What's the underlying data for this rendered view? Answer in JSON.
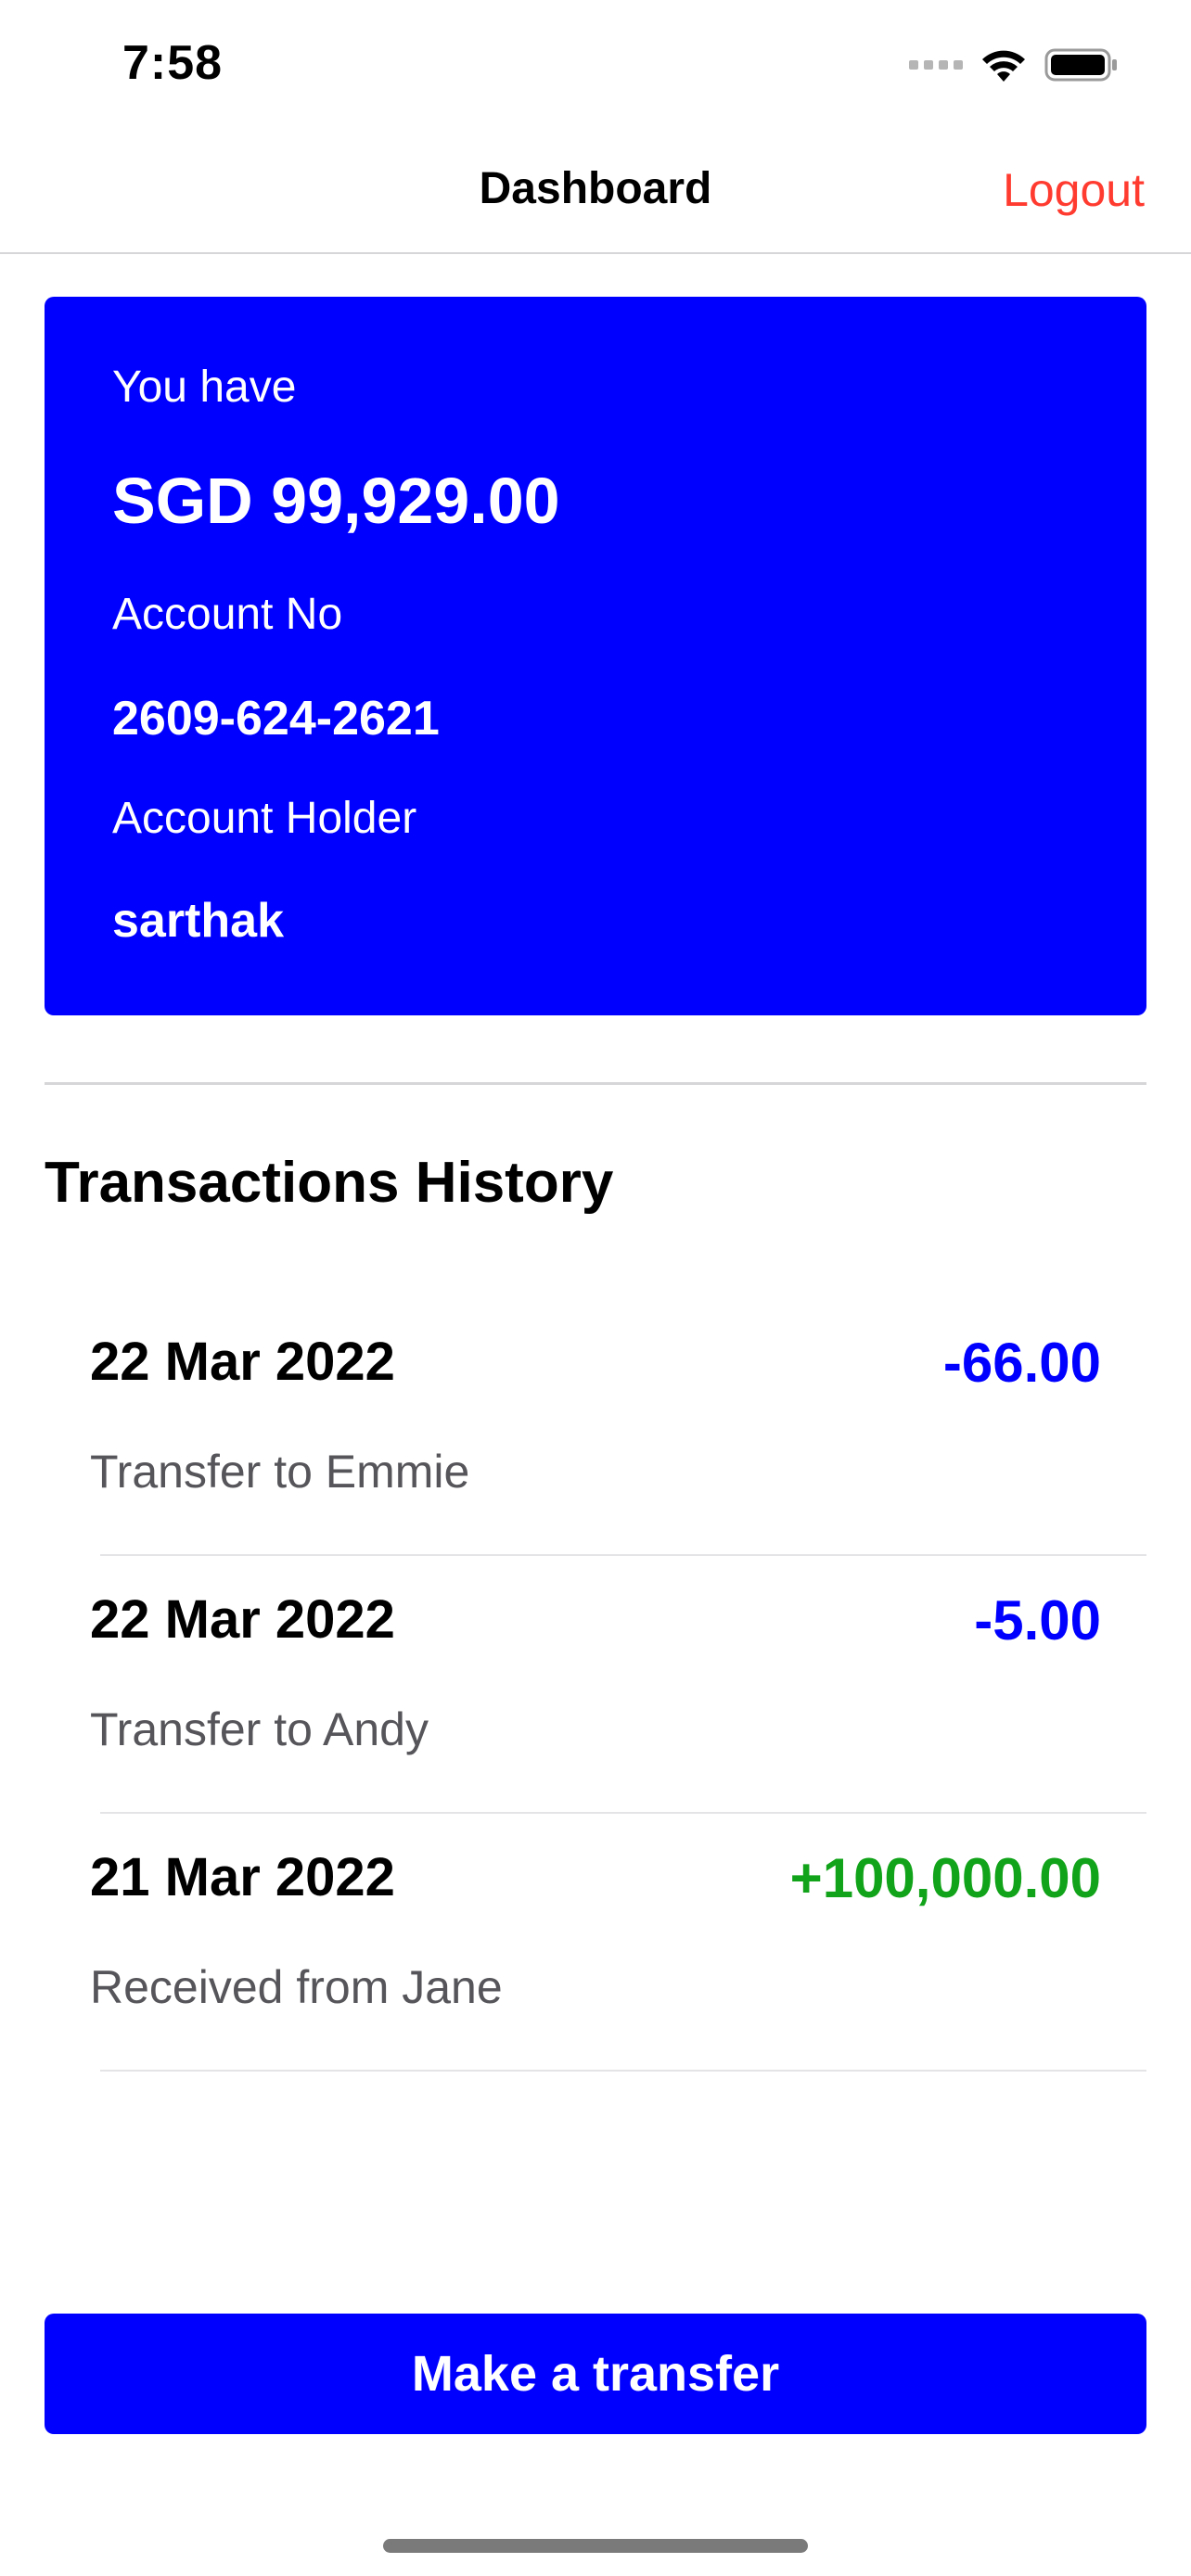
{
  "status_bar": {
    "time": "7:58",
    "icons": [
      "cellular-signal-icon",
      "wifi-icon",
      "battery-icon"
    ]
  },
  "nav": {
    "title": "Dashboard",
    "logout_label": "Logout",
    "logout_color": "#ff3b30"
  },
  "balance_card": {
    "background": "#0000ff",
    "balance_label": "You have",
    "balance": "SGD 99,929.00",
    "account_no_label": "Account No",
    "account_no": "2609-624-2621",
    "holder_label": "Account Holder",
    "holder": "sarthak"
  },
  "transactions": {
    "title": "Transactions History",
    "items": [
      {
        "date": "22 Mar 2022",
        "amount": "-66.00",
        "description": "Transfer to Emmie",
        "amount_color": "#0000ff"
      },
      {
        "date": "22 Mar 2022",
        "amount": "-5.00",
        "description": "Transfer to Andy",
        "amount_color": "#0000ff"
      },
      {
        "date": "21 Mar 2022",
        "amount": "+100,000.00",
        "description": "Received from Jane",
        "amount_color": "#11a319"
      }
    ]
  },
  "actions": {
    "transfer_label": "Make a transfer",
    "transfer_color": "#0000ff"
  }
}
